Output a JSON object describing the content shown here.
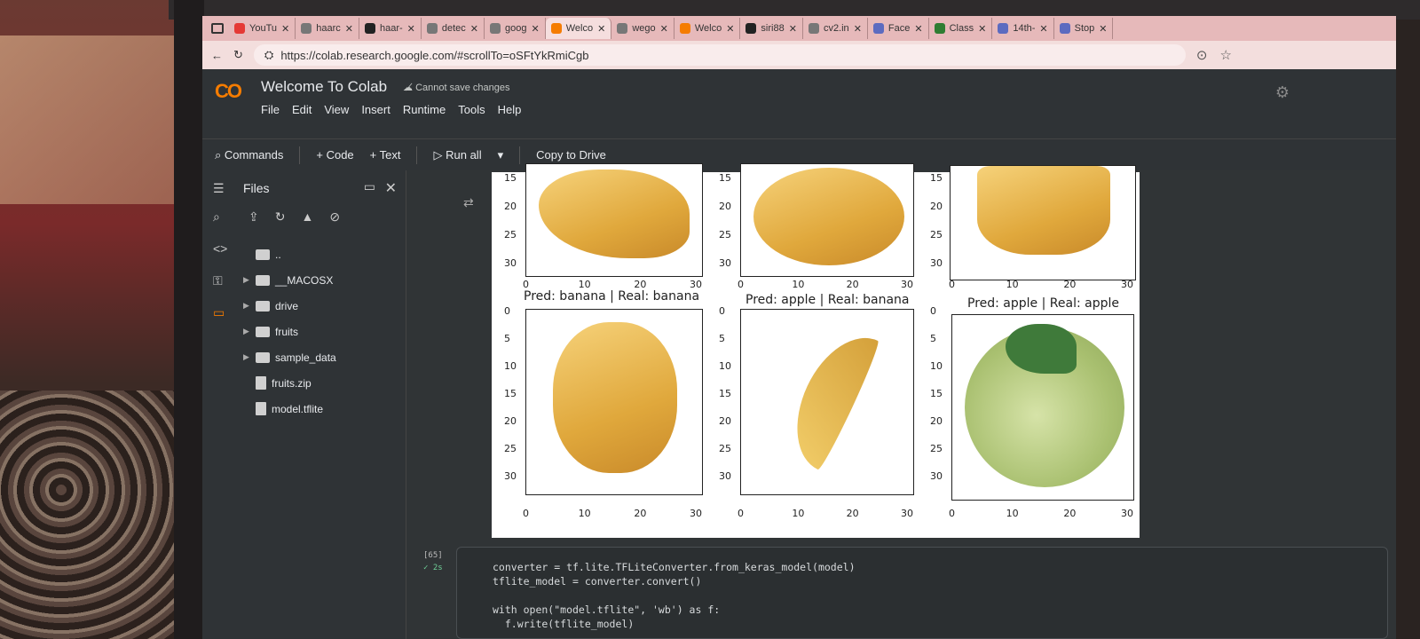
{
  "browser": {
    "tabs": [
      {
        "label": "YouTu",
        "icon": "youtube-icon",
        "active": false
      },
      {
        "label": "haarc",
        "icon": "search-icon",
        "active": false
      },
      {
        "label": "haar-",
        "icon": "github-icon",
        "active": false
      },
      {
        "label": "detec",
        "icon": "search-icon",
        "active": false
      },
      {
        "label": "goog",
        "icon": "search-icon",
        "active": false
      },
      {
        "label": "Welco",
        "icon": "colab-icon",
        "active": true
      },
      {
        "label": "wego",
        "icon": "search-icon",
        "active": false
      },
      {
        "label": "Welco",
        "icon": "colab-icon",
        "active": false
      },
      {
        "label": "siri88",
        "icon": "github-icon",
        "active": false
      },
      {
        "label": "cv2.in",
        "icon": "search-icon",
        "active": false
      },
      {
        "label": "Face",
        "icon": "web-icon",
        "active": false
      },
      {
        "label": "Class",
        "icon": "classroom-icon",
        "active": false
      },
      {
        "label": "14th-",
        "icon": "web-icon",
        "active": false
      },
      {
        "label": "Stop",
        "icon": "web-icon",
        "active": false
      }
    ],
    "url": "https://colab.research.google.com/#scrollTo=oSFtYkRmiCgb"
  },
  "colab": {
    "logo": "CO",
    "title": "Welcome To Colab",
    "save_status": "Cannot save changes",
    "menu": [
      "File",
      "Edit",
      "View",
      "Insert",
      "Runtime",
      "Tools",
      "Help"
    ],
    "toolbar": {
      "commands": "Commands",
      "code": "+ Code",
      "text": "+ Text",
      "run_all": "Run all",
      "copy_to_drive": "Copy to Drive"
    }
  },
  "files_panel": {
    "title": "Files",
    "items": [
      {
        "name": "..",
        "type": "folder",
        "expandable": false
      },
      {
        "name": "__MACOSX",
        "type": "folder",
        "expandable": true
      },
      {
        "name": "drive",
        "type": "folder",
        "expandable": true
      },
      {
        "name": "fruits",
        "type": "folder",
        "expandable": true
      },
      {
        "name": "sample_data",
        "type": "folder",
        "expandable": true
      },
      {
        "name": "fruits.zip",
        "type": "file",
        "expandable": false
      },
      {
        "name": "model.tflite",
        "type": "file",
        "expandable": false
      }
    ]
  },
  "figure": {
    "top_row_ticks_y": [
      "15",
      "20",
      "25",
      "30"
    ],
    "bottom_row_ticks_y": [
      "0",
      "5",
      "10",
      "15",
      "20",
      "25",
      "30"
    ],
    "ticks_x": [
      "0",
      "10",
      "20",
      "30"
    ],
    "panels": [
      {
        "title": "Pred: banana | Real: banana",
        "fruit": "banana"
      },
      {
        "title": "Pred: apple | Real: banana",
        "fruit": "banana"
      },
      {
        "title": "Pred: apple | Real: apple",
        "fruit": "apple"
      }
    ]
  },
  "code_cell": {
    "execution_count": "[65]",
    "exec_time": "✓ 2s",
    "lines": [
      "converter = tf.lite.TFLiteConverter.from_keras_model(model)",
      "tflite_model = converter.convert()",
      "",
      "with open(\"model.tflite\", 'wb') as f:",
      "  f.write(tflite_model)"
    ]
  },
  "colors": {
    "colab_orange": "#f57c00",
    "panel_bg": "#2f3336",
    "tab_bar": "#e6b9ba"
  }
}
